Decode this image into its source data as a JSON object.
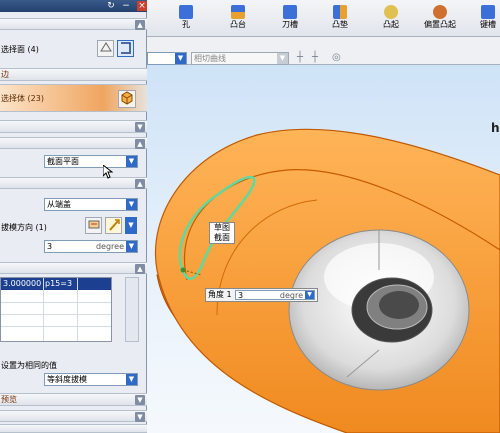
{
  "dialog": {
    "title_buttons": [
      "↻",
      "−",
      "×"
    ],
    "face_selection": {
      "label": "选择面 (4)"
    },
    "section_edge": {
      "label": "边"
    },
    "section_body": {
      "label": "选择体 (23)"
    },
    "draft_section": {
      "plane_value": "截面平面",
      "from_value": "从端盖",
      "direction_label": "拔模方向 (1)",
      "angle_value": "3",
      "angle_unit": "degree"
    },
    "list_table": {
      "cells": [
        "3.000000",
        "p15=3"
      ]
    },
    "set_equal_label": "设置为相同的值",
    "equal_draft_value": "等斜度拔模",
    "bottom_label": "预览"
  },
  "toolbar": {
    "tools": [
      {
        "label": "孔",
        "icon": "hole-icon",
        "color": "#3c6fd8"
      },
      {
        "label": "凸台",
        "icon": "boss-icon",
        "color": "#e8a030"
      },
      {
        "label": "刀槽",
        "icon": "pocket-icon",
        "color": "#3c6fd8"
      },
      {
        "label": "凸垫",
        "icon": "pad-icon",
        "color": "#3c6fd8"
      },
      {
        "label": "凸起",
        "icon": "emboss-icon",
        "color": "#e0c050"
      },
      {
        "label": "偏置凸起",
        "icon": "offset-emboss-icon",
        "color": "#d07030"
      },
      {
        "label": "键槽",
        "icon": "slot-icon",
        "color": "#3c6fd8"
      }
    ],
    "filter_placeholder": "相切曲线"
  },
  "viewport": {
    "corner_text": "h",
    "callout_lines": [
      "草图",
      "截面"
    ],
    "angle_label": "角度 1",
    "angle_value": "3",
    "angle_unit": "degre"
  },
  "colors": {
    "model_orange": "#f5902a",
    "section_green": "#5ed9a0",
    "panel_bg": "#e9ecf2",
    "accent_blue": "#2f6ac6"
  }
}
